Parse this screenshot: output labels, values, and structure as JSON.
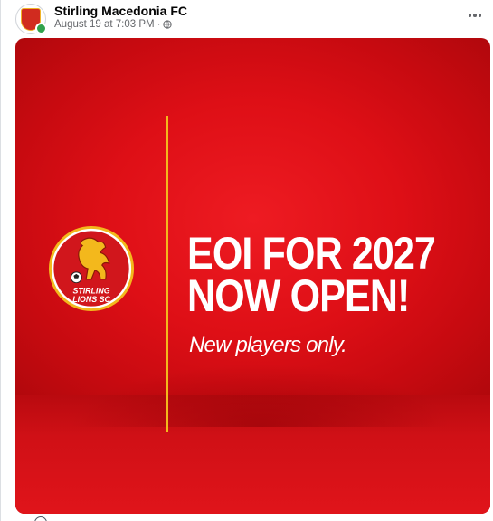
{
  "post": {
    "page_name": "Stirling Macedonia FC",
    "timestamp": "August 19 at 7:03 PM",
    "separator": "·",
    "privacy_icon": "globe-icon",
    "more_icon": "more-options-icon"
  },
  "image": {
    "headline_line1": "EOI FOR 2027",
    "headline_line2": "NOW OPEN!",
    "subline": "New players only.",
    "logo_text_line1": "STIRLING",
    "logo_text_line2": "LIONS SC",
    "colors": {
      "background": "#e2121a",
      "divider": "#f3b81c",
      "logo_ring": "#f3b81c",
      "logo_fill": "#d1161c",
      "text": "#ffffff"
    }
  }
}
